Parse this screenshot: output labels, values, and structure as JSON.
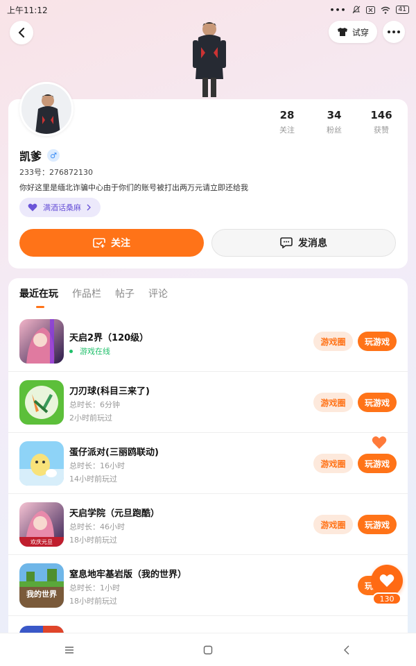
{
  "status_bar": {
    "time": "上午11:12",
    "dots": "•••",
    "battery": "41"
  },
  "header": {
    "tryon_label": "试穿"
  },
  "profile": {
    "name": "凯爹",
    "gender_symbol": "♂",
    "uid": "233号：276872130",
    "bio": "你好这里是缅北诈骗中心由于你们的账号被打出两万元请立即还给我",
    "tag": "满酒话桑麻",
    "stats": [
      {
        "num": "28",
        "label": "关注"
      },
      {
        "num": "34",
        "label": "粉丝"
      },
      {
        "num": "146",
        "label": "获赞"
      }
    ],
    "follow_label": "关注",
    "message_label": "发消息"
  },
  "tabs": [
    "最近在玩",
    "作品栏",
    "帖子",
    "评论"
  ],
  "games": [
    {
      "title": "天启2界（120级）",
      "meta1": "游戏在线",
      "meta2": "",
      "online": true,
      "icon": "anime-girl-icon",
      "color_a": "#e07aa0",
      "color_b": "#2b1b4a"
    },
    {
      "title": "刀刃球(科目三来了)",
      "meta1": "总时长：6分钟",
      "meta2": "2小时前玩过",
      "online": false,
      "icon": "blade-ball-icon",
      "color_a": "#8ed14d",
      "color_b": "#3da32f"
    },
    {
      "title": "蛋仔派对(三丽鸥联动)",
      "meta1": "总时长：16小时",
      "meta2": "14小时前玩过",
      "online": false,
      "icon": "eggy-party-icon",
      "color_a": "#7cc8f5",
      "color_b": "#f8e27a"
    },
    {
      "title": "天启学院（元旦跑酷）",
      "meta1": "总时长：46小时",
      "meta2": "18小时前玩过",
      "online": false,
      "icon": "anime-academy-icon",
      "color_a": "#f2a6c0",
      "color_b": "#3a2456",
      "badge": "欢庆元旦"
    },
    {
      "title": "窒息地牢基岩版（我的世界）",
      "meta1": "总时长：1小时",
      "meta2": "18小时前玩过",
      "online": false,
      "icon": "minecraft-icon",
      "color_a": "#5aa83a",
      "color_b": "#7a5a3a",
      "badge": "我的世界"
    }
  ],
  "buttons": {
    "circle_label": "游戏圈",
    "play_label": "玩游戏"
  },
  "fab": {
    "count": "130"
  },
  "colors": {
    "accent": "#ff7318",
    "online": "#1fbf6a",
    "tag": "#6b55d8"
  }
}
